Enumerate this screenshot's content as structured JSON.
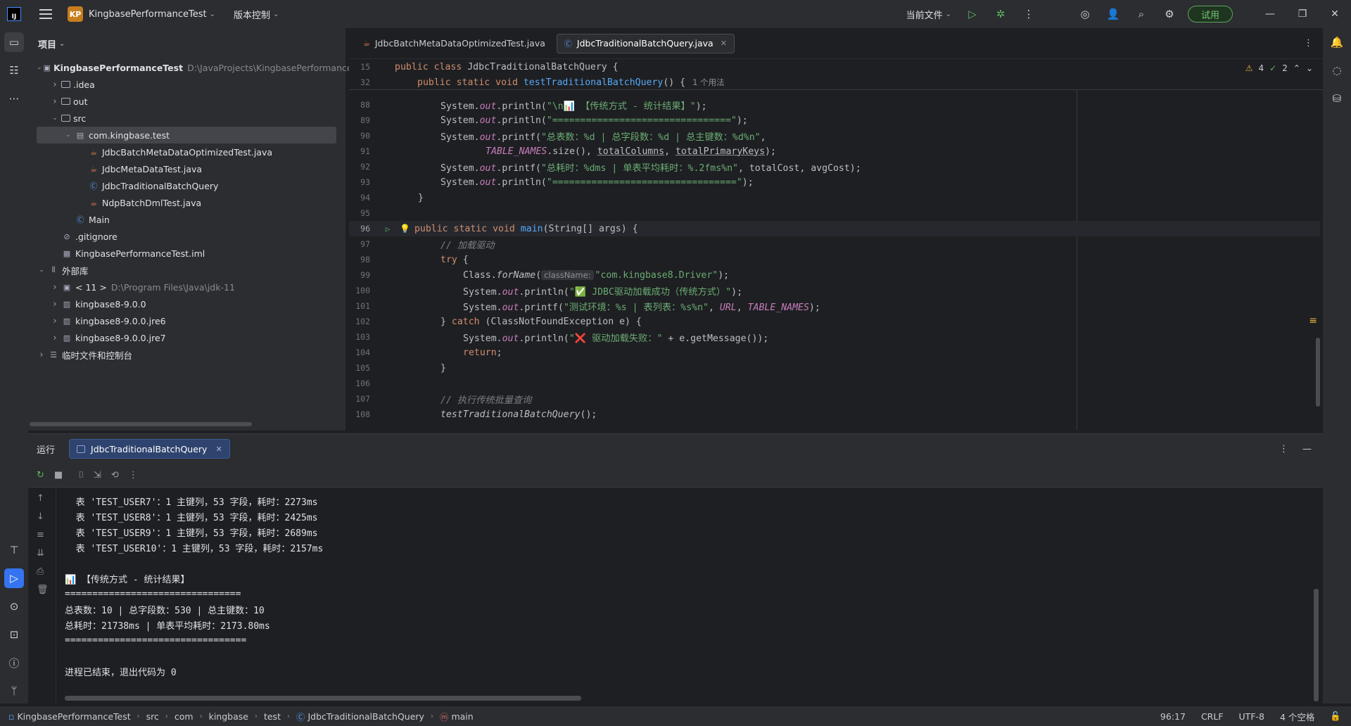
{
  "titlebar": {
    "app_logo": "IJ",
    "project_badge": "KP",
    "project_name": "KingbasePerformanceTest",
    "vcs_label": "版本控制",
    "run_config": "当前文件",
    "trial_label": "试用"
  },
  "project_panel": {
    "title": "项目",
    "tree": [
      {
        "label": "KingbasePerformanceTest",
        "hint": "D:\\JavaProjects\\KingbasePerformanceTe",
        "depth": 0,
        "arrow": "down",
        "icon": "module-icon"
      },
      {
        "label": ".idea",
        "depth": 1,
        "arrow": "right",
        "icon": "folder-icon"
      },
      {
        "label": "out",
        "depth": 1,
        "arrow": "right",
        "icon": "folder-icon"
      },
      {
        "label": "src",
        "depth": 1,
        "arrow": "down",
        "icon": "folder-icon"
      },
      {
        "label": "com.kingbase.test",
        "depth": 2,
        "arrow": "down",
        "icon": "package-icon",
        "selected": true
      },
      {
        "label": "JdbcBatchMetaDataOptimizedTest.java",
        "depth": 3,
        "icon": "java-file-icon"
      },
      {
        "label": "JdbcMetaDataTest.java",
        "depth": 3,
        "icon": "java-file-icon"
      },
      {
        "label": "JdbcTraditionalBatchQuery",
        "depth": 3,
        "icon": "class-icon"
      },
      {
        "label": "NdpBatchDmlTest.java",
        "depth": 3,
        "icon": "java-file-icon"
      },
      {
        "label": "Main",
        "depth": 2,
        "icon": "class-icon"
      },
      {
        "label": ".gitignore",
        "depth": 1,
        "icon": "gitignore-icon"
      },
      {
        "label": "KingbasePerformanceTest.iml",
        "depth": 1,
        "icon": "iml-file-icon"
      },
      {
        "label": "外部库",
        "depth": 0,
        "arrow": "down",
        "icon": "library-icon"
      },
      {
        "label": "< 11 >",
        "hint": "D:\\Program Files\\Java\\jdk-11",
        "depth": 1,
        "arrow": "right",
        "icon": "jdk-icon"
      },
      {
        "label": "kingbase8-9.0.0",
        "depth": 1,
        "arrow": "right",
        "icon": "jar-icon"
      },
      {
        "label": "kingbase8-9.0.0.jre6",
        "depth": 1,
        "arrow": "right",
        "icon": "jar-icon"
      },
      {
        "label": "kingbase8-9.0.0.jre7",
        "depth": 1,
        "arrow": "right",
        "icon": "jar-icon"
      },
      {
        "label": "临时文件和控制台",
        "depth": 0,
        "arrow": "right",
        "icon": "scratch-icon"
      }
    ]
  },
  "editor": {
    "tabs": [
      {
        "label": "JdbcBatchMetaDataOptimizedTest.java",
        "active": false
      },
      {
        "label": "JdbcTraditionalBatchQuery.java",
        "active": true
      }
    ],
    "inspections": {
      "warnings": "4",
      "checks": "2"
    },
    "sticky_line_15": "15",
    "sticky_line_32": "32",
    "usage_hint": "1 个用法",
    "hint_classname": "className:",
    "lines": {
      "n88": "88",
      "n89": "89",
      "n90": "90",
      "n91": "91",
      "n92": "92",
      "n93": "93",
      "n94": "94",
      "n95": "95",
      "n96": "96",
      "n97": "97",
      "n98": "98",
      "n99": "99",
      "n100": "100",
      "n101": "101",
      "n102": "102",
      "n103": "103",
      "n104": "104",
      "n105": "105",
      "n106": "106",
      "n107": "107",
      "n108": "108"
    },
    "code": {
      "s88": "\"\\n📊 【传统方式 - 统计结果】\"",
      "s89": "\"================================\"",
      "s90": "\"总表数：%d | 总字段数：%d | 总主键数：%d%n\"",
      "s92": "\"总耗时：%dms | 单表平均耗时：%.2fms%n\"",
      "s93": "\"=================================\"",
      "c97": "// 加载驱动",
      "s99": "\"com.kingbase8.Driver\"",
      "s100": "\"✅ JDBC驱动加载成功（传统方式）\"",
      "s101": "\"测试环境：%s | 表列表：%s%n\"",
      "s103": "\"❌ 驱动加载失败：\"",
      "c107": "// 执行传统批量查询"
    }
  },
  "run_panel": {
    "title": "运行",
    "tab_label": "JdbcTraditionalBatchQuery",
    "output": [
      "  表 'TEST_USER7'：1 主键列，53 字段，耗时：2273ms",
      "  表 'TEST_USER8'：1 主键列，53 字段，耗时：2425ms",
      "  表 'TEST_USER9'：1 主键列，53 字段，耗时：2689ms",
      "  表 'TEST_USER10'：1 主键列，53 字段，耗时：2157ms",
      "",
      "📊 【传统方式 - 统计结果】",
      "================================",
      "总表数：10 | 总字段数：530 | 总主键数：10",
      "总耗时：21738ms | 单表平均耗时：2173.80ms",
      "=================================",
      "",
      "进程已结束，退出代码为 0"
    ]
  },
  "statusbar": {
    "crumbs": [
      "KingbasePerformanceTest",
      "src",
      "com",
      "kingbase",
      "test",
      "JdbcTraditionalBatchQuery",
      "main"
    ],
    "position": "96:17",
    "line_ending": "CRLF",
    "encoding": "UTF-8",
    "indent": "4 个空格"
  }
}
